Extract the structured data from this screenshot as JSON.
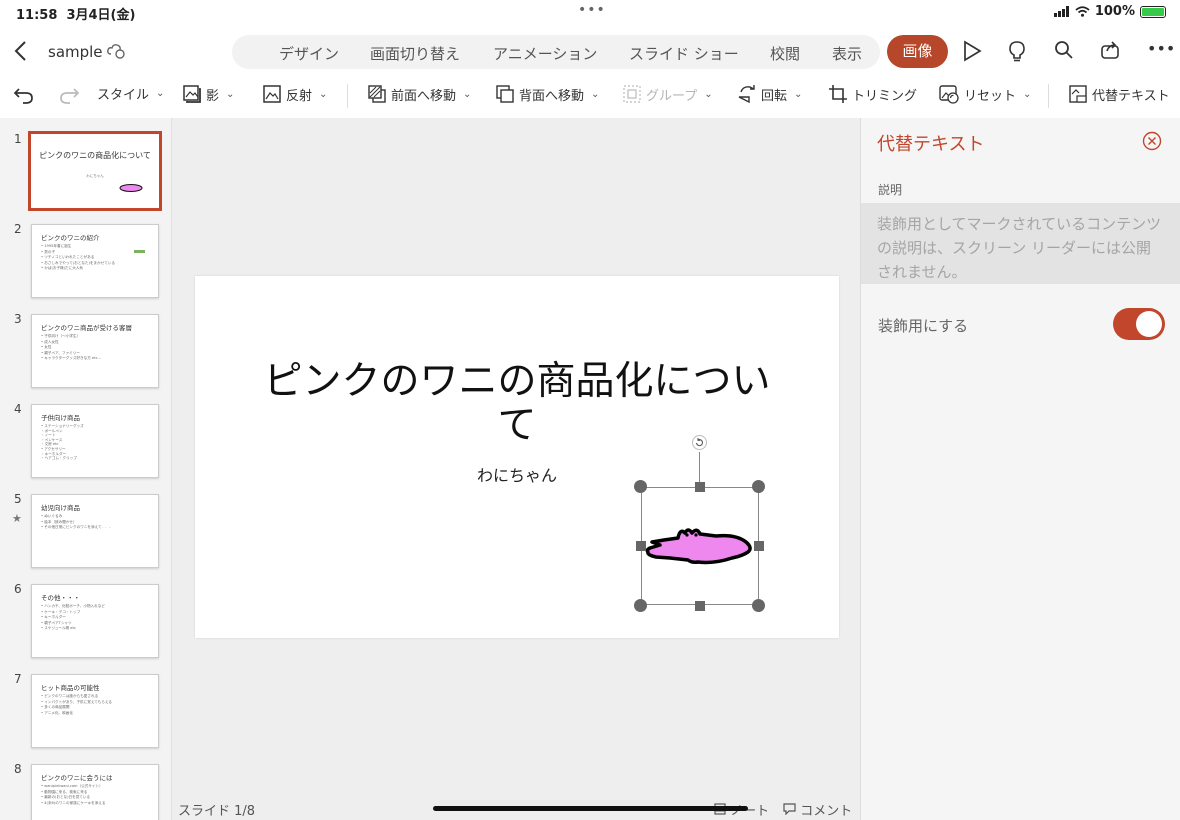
{
  "status_bar": {
    "time": "11:58",
    "date": "3月4日(金)",
    "battery": "100%"
  },
  "titlebar": {
    "file_name": "sample",
    "tabs": [
      "デザイン",
      "画面切り替え",
      "アニメーション",
      "スライド ショー",
      "校閲",
      "表示"
    ],
    "active_tab": "画像"
  },
  "ribbon": {
    "style": "スタイル",
    "shadow": "影",
    "reflection": "反射",
    "bring_forward": "前面へ移動",
    "send_backward": "背面へ移動",
    "group": "グループ",
    "rotate": "回転",
    "crop": "トリミング",
    "reset": "リセット",
    "alt_text": "代替テキスト"
  },
  "slides": [
    {
      "num": "1",
      "title": "ピンクのワニの商品化について",
      "subtitle": "わにちゃん"
    },
    {
      "num": "2",
      "title": "ピンクのワニの紹介",
      "lines": [
        "• 1995年春に誕生",
        "• 男の子",
        "• ツチノコといわれたことがある",
        "• おさしみでやって(おとなた)をまかせている",
        "• かば(お子様)だに大人気"
      ]
    },
    {
      "num": "3",
      "title": "ピンクのワニ商品が受ける客層",
      "lines": [
        "• 子供向け（〜小学生）",
        "• 成人女性",
        "• 女性",
        "• 親子ペア、ファミリー",
        "• キャラクターグッズ好きな方 etc..."
      ]
    },
    {
      "num": "4",
      "title": "子供向け商品",
      "lines": [
        "• ステーショナリーグッズ",
        "  ・ボールペン",
        "  ・ノート",
        "  ・ペンケース",
        "  ・文房 etc",
        "• アクセサリー",
        "  ・キーホルダー",
        "  ・ヘアゴム・クリップ"
      ]
    },
    {
      "num": "5",
      "title": "幼児向け商品",
      "lines": [
        "• ぬいぐるみ",
        "• 絵本（読み聞かせ）",
        "• その他日常にピンクのワニを添えて．．．"
      ]
    },
    {
      "num": "6",
      "title": "その他・・・",
      "lines": [
        "• ハンカチ、化粧ポーチ、小物入れなど",
        "• ケーキ・デコ・トップ",
        "• キーホルダー",
        "• 親子ペアTシャツ",
        "• スケジュール帳 etc"
      ]
    },
    {
      "num": "7",
      "title": "ヒット商品の可能性",
      "lines": [
        "• ピンクのワニは誰からも愛される",
        "• インパクトがあり、子供に覚えてもらえる",
        "• 多くの商品展開",
        "• アニメ化、映画化"
      ]
    },
    {
      "num": "8",
      "title": "ピンクのワニに会うには",
      "lines": [
        "• wanipinkwani.com（公式サイト）",
        "• 動物園に来る、検索に来る",
        "• 最新の(おとな)日を見ている",
        "• 4(未6)のワニの家族にケーキを添える"
      ]
    }
  ],
  "canvas": {
    "current_slide_title": "ピンクのワニの商品化について",
    "current_slide_subtitle": "わにちゃん",
    "slide_counter": "スライド 1/8",
    "notes": "ノート",
    "comments": "コメント"
  },
  "panel": {
    "title": "代替テキスト",
    "description_label": "説明",
    "description_placeholder": "装飾用としてマークされているコンテンツの説明は、スクリーン リーダーには公開されません。",
    "decorative_label": "装飾用にする",
    "decorative_on": true
  },
  "colors": {
    "accent": "#c2462c",
    "croc_fill": "#ee88ee"
  }
}
